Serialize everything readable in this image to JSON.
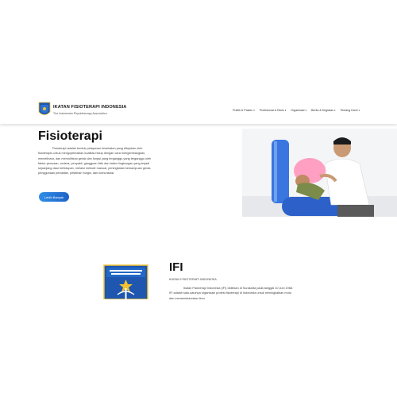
{
  "header": {
    "brand_name": "IKATAN FISIOTERAPI INDONESIA",
    "brand_sub": "The Indonesian Physiotherapy Association",
    "nav": [
      {
        "label": "Publik & Pasien"
      },
      {
        "label": "Profesional & Klinis"
      },
      {
        "label": "Organisasi"
      },
      {
        "label": "Berita & Kegiatan"
      },
      {
        "label": "Tentang Kami"
      }
    ]
  },
  "hero": {
    "title": "Fisioterapi",
    "text": "Fisioterapi adalah bentuk pelayanan kesehatan yang ditujukan oleh fisioterapis untuk mengoptimalkan kualitas hidup dengan cara mengembangkan, memelihara, dan memulihkan gerak dan fungsi yang terganggu yang terganggu oleh faktor-penuaan, cedera, penyakit, gangguan fisik dan faktor lingkungan yang terjadi sepanjang daur kehidupan, melalui metode manual, peningkatan kemampuan gerak, penggunaan peralatan, pelatihan fungsi, dan komunikasi.",
    "cta_label": "Lebih Banyak"
  },
  "about": {
    "title": "IFI",
    "subtitle": "IKATAN FISIOTERAPI INDONESIA",
    "text": "Ikatan Fisioterapi Indonesia (IFI) didirikan di Surakarta pada tanggal 10 Juni 1968. IFI adalah satu-satunya organisasi profesi fisioterapi di Indonesia untuk meningkatkan mutu dan mengembangkan ilmu"
  },
  "colors": {
    "cta_start": "#2f8ee6",
    "cta_end": "#1f63c8",
    "logo_blue": "#1e56b0",
    "logo_yellow": "#f2c230"
  }
}
